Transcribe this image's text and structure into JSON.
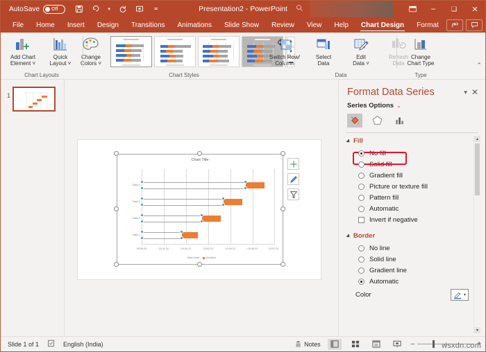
{
  "titlebar": {
    "autosave_label": "AutoSave",
    "autosave_state": "Off",
    "doc_title": "Presentation2  -  PowerPoint",
    "qat": [
      {
        "name": "save-icon",
        "glyph": "⌴"
      },
      {
        "name": "undo-icon",
        "glyph": "↶"
      },
      {
        "name": "undo-dropdown-icon",
        "glyph": "⌄"
      },
      {
        "name": "redo-icon",
        "glyph": "↻"
      },
      {
        "name": "start-presentation-icon",
        "glyph": "⬒"
      },
      {
        "name": "customize-qat-icon",
        "glyph": "⩞"
      }
    ],
    "search_icon": "⌕",
    "window_buttons": [
      {
        "name": "ribbon-display-options",
        "glyph": "⬒"
      },
      {
        "name": "minimize-button",
        "glyph": "–"
      },
      {
        "name": "maximize-button",
        "glyph": "☐"
      },
      {
        "name": "close-button",
        "glyph": "✕"
      }
    ]
  },
  "tabs": [
    {
      "label": "File",
      "active": false
    },
    {
      "label": "Home",
      "active": false
    },
    {
      "label": "Insert",
      "active": false
    },
    {
      "label": "Design",
      "active": false
    },
    {
      "label": "Transitions",
      "active": false
    },
    {
      "label": "Animations",
      "active": false
    },
    {
      "label": "Slide Show",
      "active": false
    },
    {
      "label": "Review",
      "active": false
    },
    {
      "label": "View",
      "active": false
    },
    {
      "label": "Help",
      "active": false
    },
    {
      "label": "Chart Design",
      "active": true
    },
    {
      "label": "Format",
      "active": false
    }
  ],
  "tabbar_buttons": [
    {
      "name": "share-button",
      "glyph": "➦"
    },
    {
      "name": "comments-button",
      "glyph": "὞9"
    }
  ],
  "ribbon": {
    "groups": [
      {
        "name": "chart-layouts",
        "title": "Chart Layouts",
        "buttons": [
          {
            "name": "add-chart-element-button",
            "label": "Add Chart\nElement ˇ",
            "icon": "add-chart-element-icon"
          },
          {
            "name": "quick-layout-button",
            "label": "Quick\nLayout ˇ",
            "icon": "quick-layout-icon"
          }
        ]
      },
      {
        "name": "chart-styles",
        "title": "Chart Styles",
        "buttons": [
          {
            "name": "change-colors-button",
            "label": "Change\nColors ˇ",
            "icon": "palette-icon"
          }
        ],
        "gallery_count": 4,
        "gallery_selected_index": 0
      },
      {
        "name": "data",
        "title": "Data",
        "buttons": [
          {
            "name": "switch-row-column-button",
            "label": "Switch Row/\nColumn",
            "icon": "switch-row-column-icon",
            "disabled": false
          },
          {
            "name": "select-data-button",
            "label": "Select\nData",
            "icon": "select-data-icon",
            "disabled": false
          },
          {
            "name": "edit-data-button",
            "label": "Edit\nData ˇ",
            "icon": "edit-data-icon",
            "disabled": false
          },
          {
            "name": "refresh-data-button",
            "label": "Refresh\nData",
            "icon": "refresh-data-icon",
            "disabled": true
          }
        ]
      },
      {
        "name": "type",
        "title": "Type",
        "buttons": [
          {
            "name": "change-chart-type-button",
            "label": "Change\nChart Type",
            "icon": "change-chart-type-icon"
          }
        ]
      }
    ],
    "collapse_glyph": "⌃"
  },
  "thumbnails": {
    "slides": [
      {
        "number": "1"
      }
    ]
  },
  "chart_data": {
    "type": "bar",
    "chart_kind": "gantt",
    "title": "Chart Title",
    "categories": [
      "Task 4",
      "Task 3",
      "Task 2",
      "Task 1"
    ],
    "series": [
      {
        "name": "Start Date",
        "color": "#4472c4",
        "values": [
          196,
          154,
          107,
          45
        ]
      },
      {
        "name": "Duration",
        "color": "#ed7d31",
        "values": [
          27,
          27,
          27,
          22
        ]
      }
    ],
    "xlabel": "",
    "ylabel": "",
    "x_tick_labels": [
      "25-09-20",
      "15-11-20",
      "04-01-21",
      "23-02-21",
      "14-04-21",
      "03-06-21",
      "23-07-21"
    ],
    "legend": [
      "Start Date",
      "Duration"
    ],
    "legend_position": "bottom",
    "grid": true
  },
  "chart_tools": [
    {
      "name": "chart-elements-button",
      "glyph": "+"
    },
    {
      "name": "chart-styles-button",
      "glyph": "✎"
    },
    {
      "name": "chart-filters-button",
      "glyph": "∇"
    }
  ],
  "format_pane": {
    "title": "Format Data Series",
    "caret_glyph": "▾",
    "close_glyph": "✕",
    "subtitle": "Series Options",
    "subtitle_chevron": "⌄",
    "icon_tabs": [
      {
        "name": "fill-and-line-tab",
        "selected": true
      },
      {
        "name": "effects-tab",
        "selected": false
      },
      {
        "name": "series-options-tab",
        "selected": false
      }
    ],
    "sections": [
      {
        "name": "fill",
        "heading": "Fill",
        "options": [
          {
            "label": "No fill",
            "type": "radio",
            "selected": true,
            "highlighted": true
          },
          {
            "label": "Solid fill",
            "type": "radio",
            "selected": false
          },
          {
            "label": "Gradient fill",
            "type": "radio",
            "selected": false
          },
          {
            "label": "Picture or texture fill",
            "type": "radio",
            "selected": false
          },
          {
            "label": "Pattern fill",
            "type": "radio",
            "selected": false
          },
          {
            "label": "Automatic",
            "type": "radio",
            "selected": false
          },
          {
            "label": "Invert if negative",
            "type": "checkbox",
            "selected": false
          }
        ]
      },
      {
        "name": "border",
        "heading": "Border",
        "options": [
          {
            "label": "No line",
            "type": "radio",
            "selected": false
          },
          {
            "label": "Solid line",
            "type": "radio",
            "selected": false
          },
          {
            "label": "Gradient line",
            "type": "radio",
            "selected": false
          },
          {
            "label": "Automatic",
            "type": "radio",
            "selected": true
          }
        ]
      }
    ],
    "color_row": {
      "label": "Color",
      "button_name": "color-picker-button"
    }
  },
  "statusbar": {
    "slide_indicator": "Slide 1 of 1",
    "accessibility_icon": "☑",
    "language": "English (India)",
    "notes_label": "Notes",
    "views": [
      {
        "name": "normal-view-button",
        "glyph": "▤",
        "active": true
      },
      {
        "name": "slide-sorter-button",
        "glyph": "☰",
        "active": false
      },
      {
        "name": "reading-view-button",
        "glyph": "▥",
        "active": false
      },
      {
        "name": "slideshow-button",
        "glyph": "⬒",
        "active": false
      }
    ],
    "zoom_out": "–",
    "zoom_in": "+",
    "watermark": "wsxdn.com"
  },
  "colors": {
    "brand": "#b7472a",
    "accent_orange": "#ed7d31",
    "accent_blue": "#4472c4",
    "marker_blue": "#4a90d9",
    "highlight_red": "#e8112d"
  }
}
